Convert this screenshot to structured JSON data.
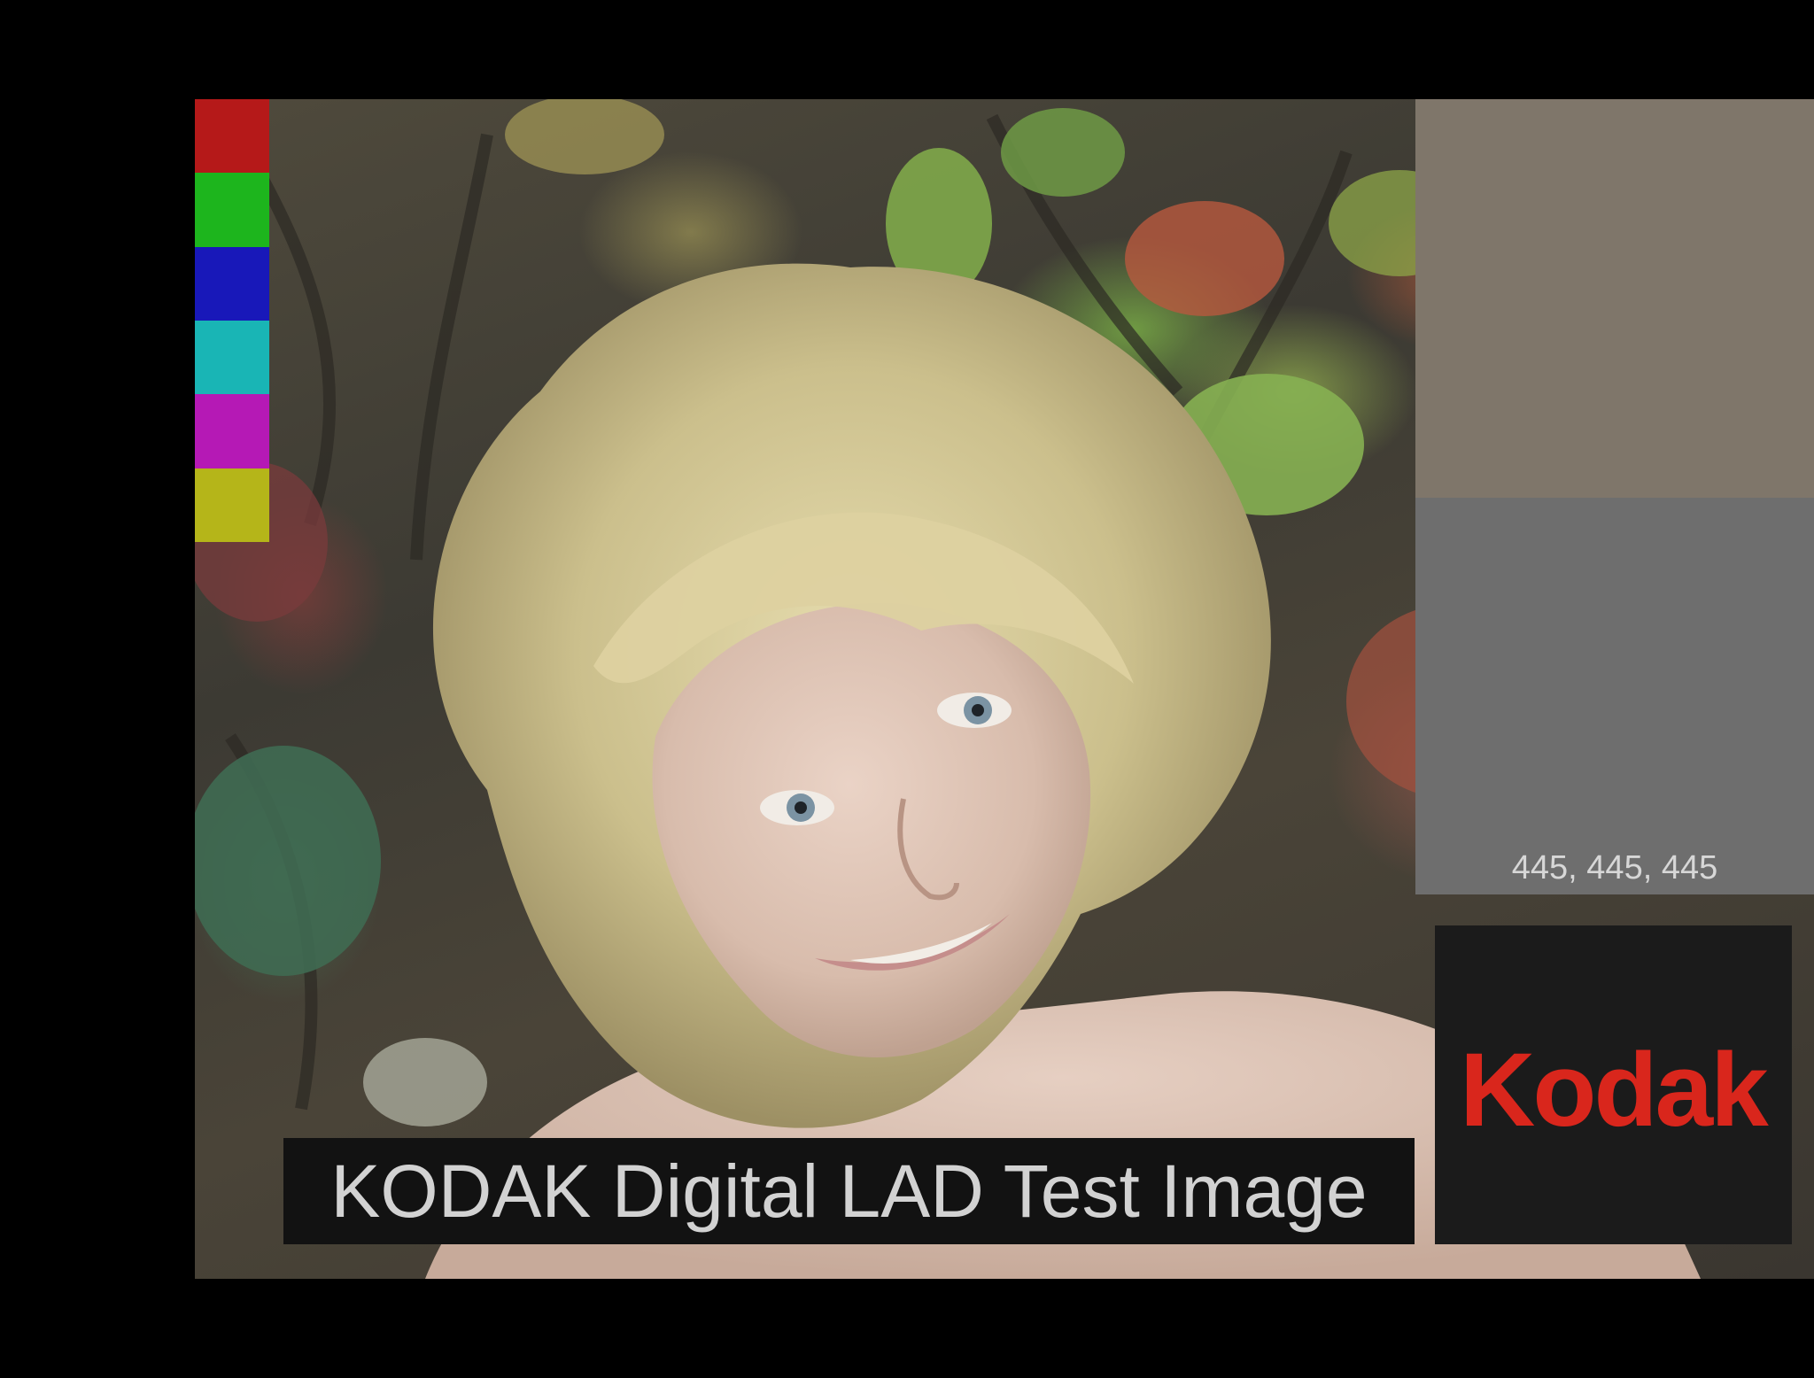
{
  "image": {
    "subject": "portrait-of-woman-with-curly-blonde-hair-against-foliage",
    "background_color": "#000000"
  },
  "color_patches": [
    {
      "name": "red",
      "color": "#b51919"
    },
    {
      "name": "green",
      "color": "#1db51d"
    },
    {
      "name": "blue",
      "color": "#1818b9"
    },
    {
      "name": "cyan",
      "color": "#19b5b5"
    },
    {
      "name": "magenta",
      "color": "#b519b5"
    },
    {
      "name": "yellow",
      "color": "#b5b519"
    }
  ],
  "gray_patches": {
    "top_color": "#7f766a",
    "bottom_color": "#6e6e6e",
    "bottom_value_text": "445, 445, 445"
  },
  "logo": {
    "text": "Kodak",
    "text_color": "#d9261c",
    "box_color": "#1b1b1b"
  },
  "caption": {
    "text": "KODAK Digital LAD Test Image"
  }
}
